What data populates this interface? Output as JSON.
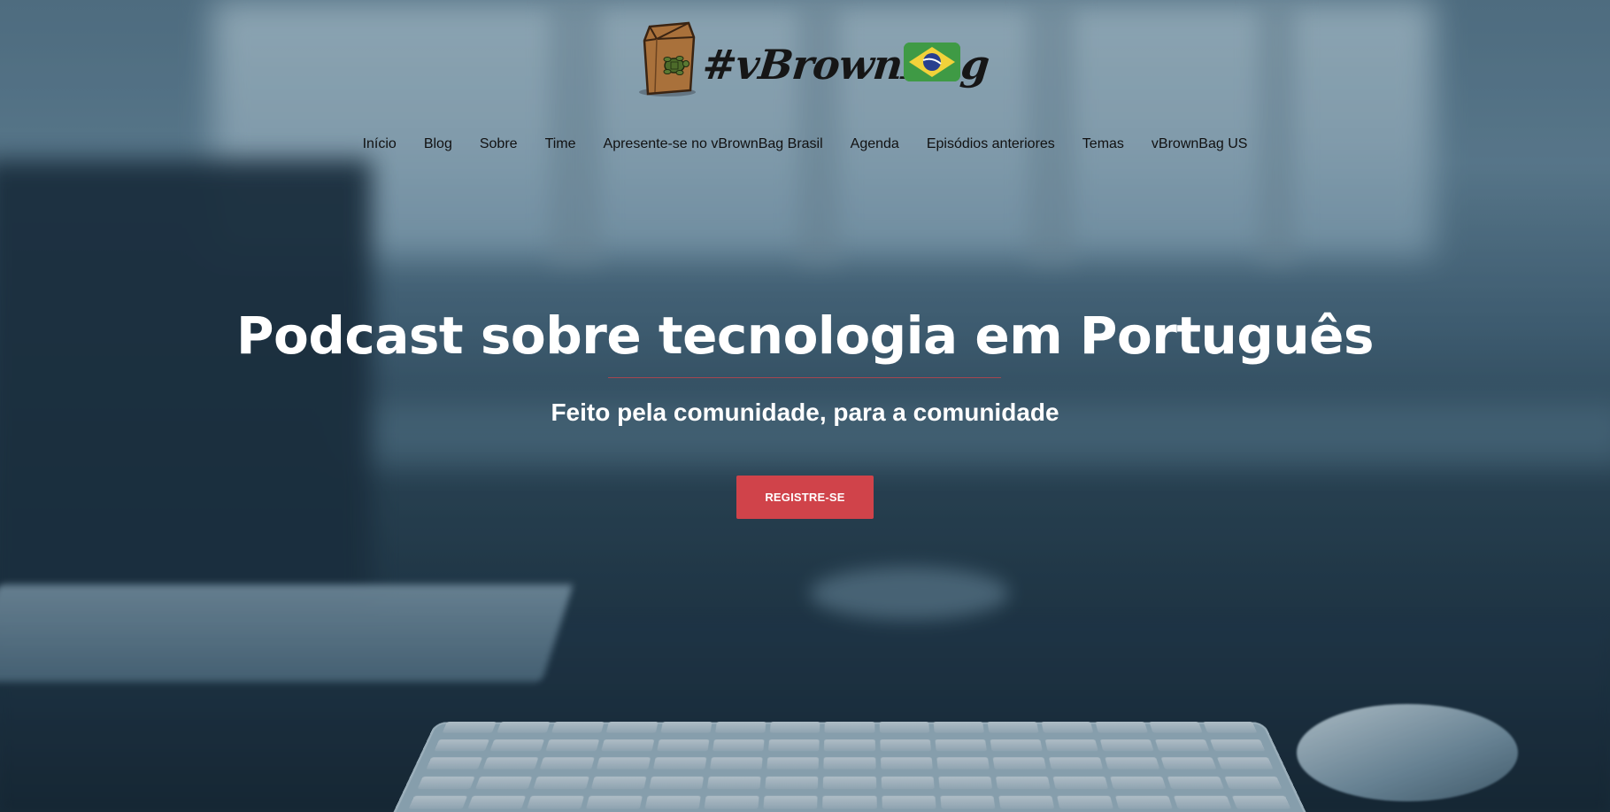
{
  "brand": {
    "logo_text": "#vBrownBag",
    "flag_icon": "brazil-flag-icon"
  },
  "nav": {
    "items": [
      {
        "label": "Início"
      },
      {
        "label": "Blog"
      },
      {
        "label": "Sobre"
      },
      {
        "label": "Time"
      },
      {
        "label": "Apresente-se no vBrownBag Brasil"
      },
      {
        "label": "Agenda"
      },
      {
        "label": "Episódios anteriores"
      },
      {
        "label": "Temas"
      },
      {
        "label": "vBrownBag US"
      }
    ]
  },
  "hero": {
    "title": "Podcast sobre tecnologia em Português",
    "subtitle": "Feito pela comunidade, para a comunidade",
    "cta_label": "REGISTRE-SE"
  },
  "colors": {
    "accent": "#d0434a",
    "nav_text": "#111111",
    "hero_text": "#ffffff"
  }
}
